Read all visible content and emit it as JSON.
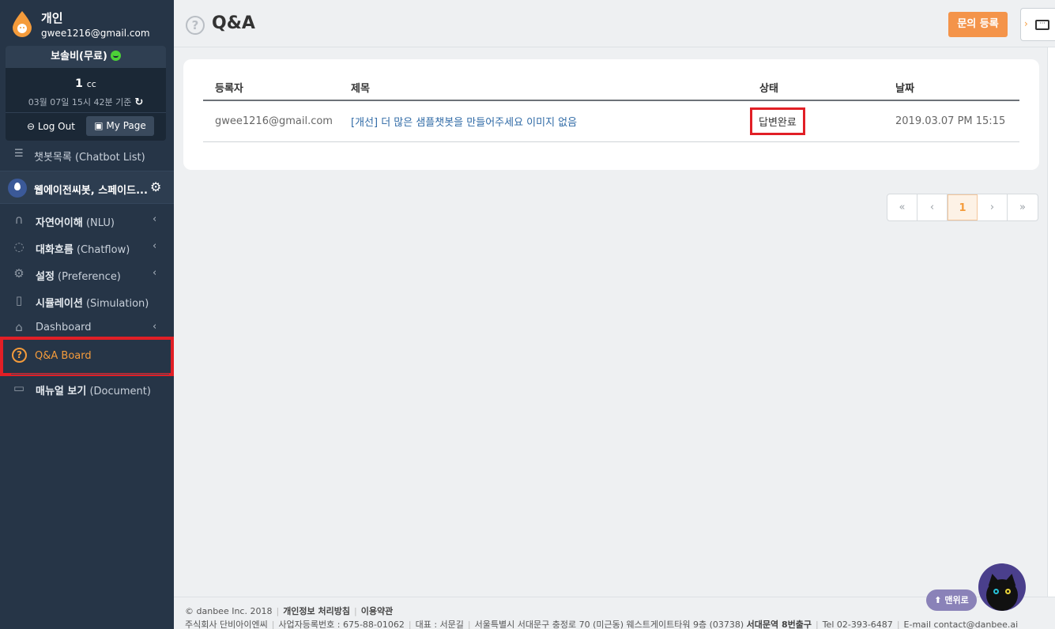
{
  "profile": {
    "name": "개인",
    "email": "gwee1216@gmail.com"
  },
  "plan": {
    "title": "보솔비(무료)",
    "cc_value": "1",
    "cc_unit": "cc",
    "cc_date": "03월 07일 15시 42분 기준",
    "refresh_icon": "refresh-icon",
    "logout_label": "Log Out",
    "mypage_label": "My Page"
  },
  "sidebar": {
    "chatbot_list": {
      "label": "챗봇목록 (Chatbot List)",
      "icon": "list-icon"
    },
    "bot": {
      "name": "웹에이전씨봇, 스페이드...",
      "icon": "bot-icon"
    },
    "items": [
      {
        "bold": "자연어이해",
        "rest": " (NLU)",
        "icon": "headphones-icon",
        "chevron": "‹"
      },
      {
        "bold": "대화흐름",
        "rest": " (Chatflow)",
        "icon": "chat-bubbles-icon",
        "chevron": "‹"
      },
      {
        "bold": "설정",
        "rest": " (Preference)",
        "icon": "gears-icon",
        "chevron": "‹"
      },
      {
        "bold": "시뮬레이션",
        "rest": " (Simulation)",
        "icon": "phone-icon",
        "chevron": ""
      },
      {
        "bold": "",
        "rest": "Dashboard",
        "icon": "chart-board-icon",
        "chevron": "‹"
      }
    ],
    "qa_board": {
      "label": "Q&A Board",
      "icon": "question-circle-icon"
    },
    "manual": {
      "bold": "매뉴얼 보기",
      "rest": " (Document)",
      "icon": "book-icon"
    }
  },
  "header": {
    "title": "Q&A",
    "inquiry_button": "문의 등록",
    "chat_arrow": "›"
  },
  "table": {
    "columns": [
      "등록자",
      "제목",
      "상태",
      "날짜"
    ],
    "rows": [
      {
        "author": "gwee1216@gmail.com",
        "title": "[개선] 더 많은 샘플챗봇을 만들어주세요 이미지 없음",
        "status": "답변완료",
        "date": "2019.03.07 PM 15:15"
      }
    ]
  },
  "pagination": {
    "first": "«",
    "prev": "‹",
    "current": "1",
    "next": "›",
    "last": "»"
  },
  "footer": {
    "copyright": "© danbee Inc. 2018",
    "privacy": "개인정보 처리방침",
    "terms": "이용약관",
    "company": "주식회사 단비아이엔씨",
    "biz_no": "사업자등록번호 : 675-88-01062",
    "ceo": "대표 : 서문길",
    "address": "서울특별시 서대문구 충정로 70 (미근동) 웨스트게이트타워 9층 (03738)",
    "station": "서대문역 8번출구",
    "tel": "Tel 02-393-6487",
    "email": "E-mail contact@danbee.ai"
  },
  "top_button": "⬆ 맨위로",
  "colors": {
    "accent": "#f49b3b",
    "sidebar": "#263547",
    "highlight": "#e11f26"
  }
}
